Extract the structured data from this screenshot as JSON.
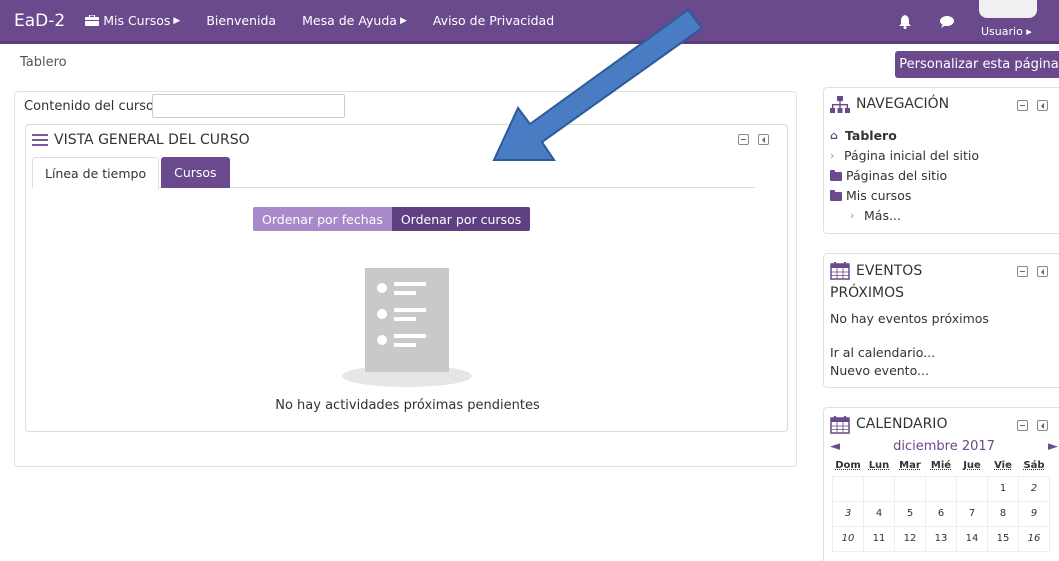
{
  "navbar": {
    "brand": "EaD-2",
    "items": [
      {
        "label": "Mis Cursos",
        "has_caret": true,
        "has_icon": true
      },
      {
        "label": "Bienvenida",
        "has_caret": false
      },
      {
        "label": "Mesa de Ayuda",
        "has_caret": true
      },
      {
        "label": "Aviso de Privacidad",
        "has_caret": false
      }
    ],
    "user_label": "Usuario ▸",
    "icons": [
      "bell-icon",
      "chat-bubble-icon"
    ],
    "color": "#6a4a8c"
  },
  "header": {
    "breadcrumb": "Tablero",
    "customize_button": "Personalizar esta página"
  },
  "main": {
    "filter_label": "Contenido del curso:",
    "filter_value": "",
    "overview": {
      "title": "VISTA GENERAL DEL CURSO",
      "tabs": [
        {
          "label": "Línea de tiempo",
          "active": true
        },
        {
          "label": "Cursos",
          "active": false
        }
      ],
      "sort_buttons": [
        {
          "label": "Ordenar por fechas",
          "selected": true
        },
        {
          "label": "Ordenar por cursos",
          "selected": false
        }
      ],
      "empty_message": "No hay actividades próximas pendientes"
    }
  },
  "sidebar": {
    "navigation": {
      "title": "NAVEGACIÓN",
      "items": [
        {
          "label": "Tablero",
          "bold": true,
          "icon": "home-icon"
        },
        {
          "label": "Página inicial del sitio",
          "bold": false,
          "icon": "chevron-right-icon"
        },
        {
          "label": "Páginas del sitio",
          "bold": false,
          "icon": "folder-icon"
        },
        {
          "label": "Mis cursos",
          "bold": false,
          "icon": "folder-open-icon"
        },
        {
          "label": "Más...",
          "bold": false,
          "icon": "chevron-right-icon"
        }
      ]
    },
    "events": {
      "title_line1": "EVENTOS",
      "title_line2": "PRÓXIMOS",
      "no_events": "No hay eventos próximos",
      "goto_calendar": "Ir al calendario...",
      "new_event": "Nuevo evento..."
    },
    "calendar": {
      "title": "CALENDARIO",
      "month": "diciembre 2017",
      "prev": "◄",
      "next": "►",
      "weekdays": [
        "Dom",
        "Lun",
        "Mar",
        "Mié",
        "Jue",
        "Vie",
        "Sáb"
      ],
      "weeks": [
        [
          "",
          "",
          "",
          "",
          "",
          "1",
          "2"
        ],
        [
          "3",
          "4",
          "5",
          "6",
          "7",
          "8",
          "9"
        ],
        [
          "10",
          "11",
          "12",
          "13",
          "14",
          "15",
          "16"
        ]
      ]
    }
  }
}
